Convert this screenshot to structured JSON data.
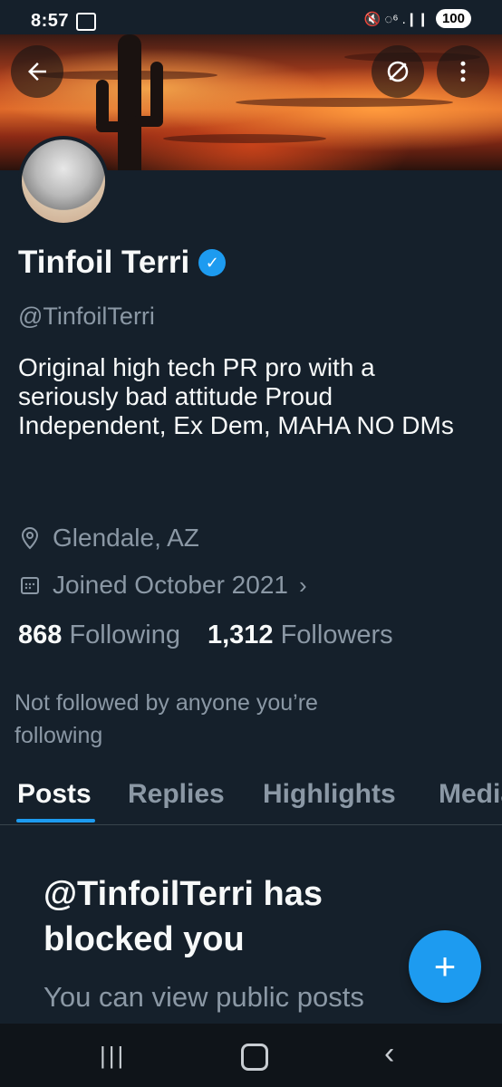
{
  "status_bar": {
    "time": "8:57",
    "right_text": "🔇 ◌⁶ .❙❙",
    "battery": "100"
  },
  "header": {
    "back_icon": "arrow-left-icon",
    "mute_icon": "slash-circle-icon",
    "more_icon": "more-vertical-icon"
  },
  "profile": {
    "display_name": "Tinfoil Terri",
    "handle": "@TinfoilTerri",
    "bio": "Original high tech PR pro with a seriously bad attitude Proud Independent, Ex Dem, MAHA NO DMs",
    "location": "Glendale, AZ",
    "joined": "Joined October 2021",
    "following_count": "868",
    "following_label": "Following",
    "followers_count": "1,312",
    "followers_label": "Followers",
    "not_followed_text": "Not followed by anyone you’re following"
  },
  "tabs": [
    {
      "label": "Posts",
      "active": true
    },
    {
      "label": "Replies",
      "active": false
    },
    {
      "label": "Highlights",
      "active": false
    },
    {
      "label": "Media",
      "active": false
    }
  ],
  "blocked": {
    "title": "@TinfoilTerri has blocked you",
    "subtitle": "You can view public posts"
  },
  "fab_label": "+",
  "colors": {
    "background": "#15202b",
    "accent": "#1d9bf0",
    "secondary_text": "#8b98a5"
  }
}
